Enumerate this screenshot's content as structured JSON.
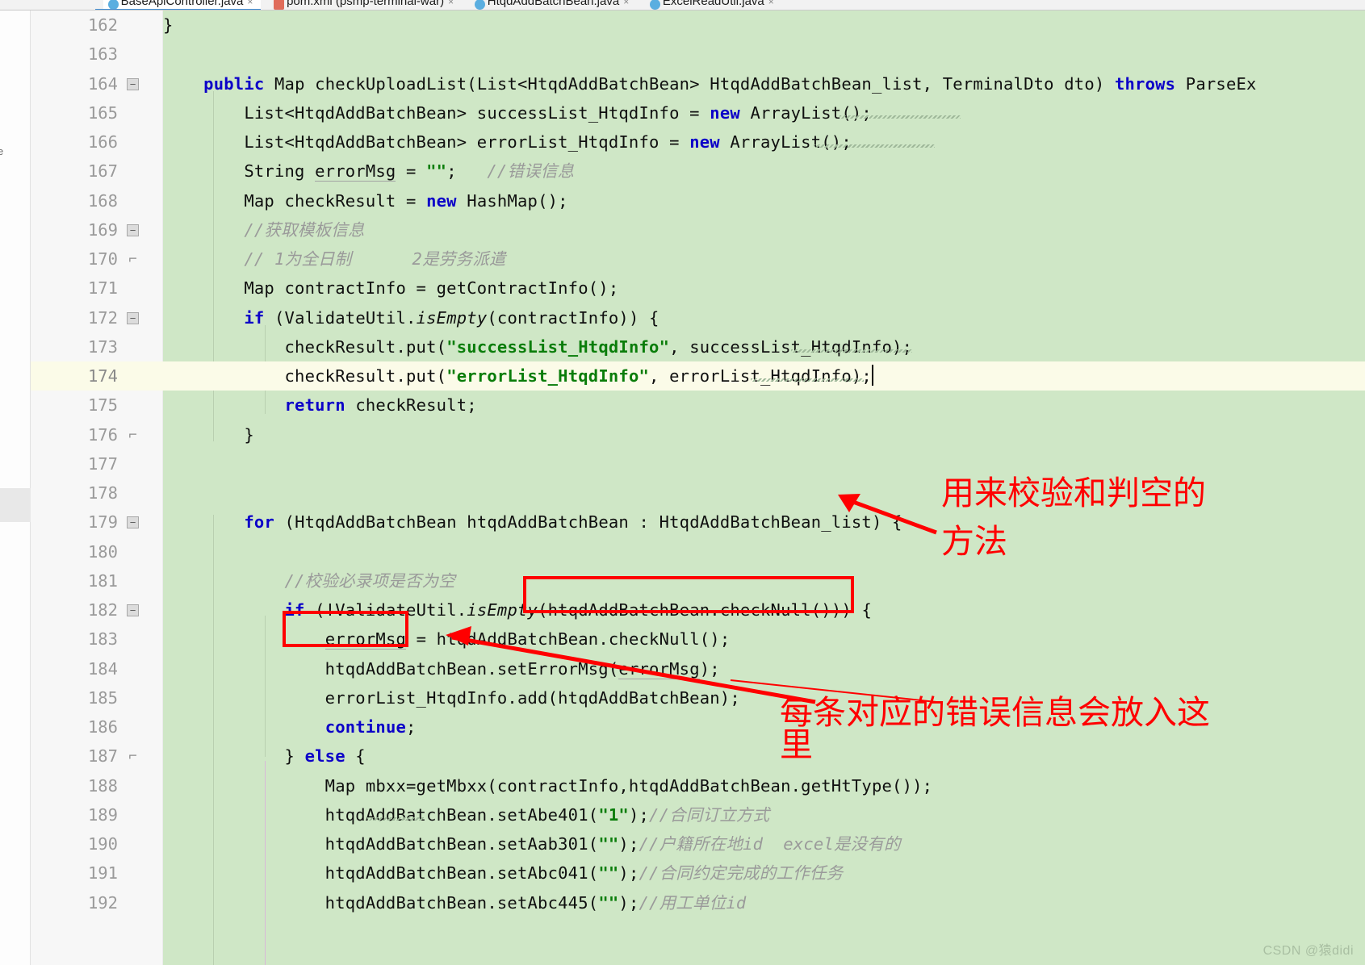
{
  "editor": {
    "tabs": [
      {
        "label": "BaseApiController.java",
        "icon": "java-class-icon",
        "active": true
      },
      {
        "label": "pom.xml (psmp-terminal-war)",
        "icon": "xml-file-icon",
        "active": false
      },
      {
        "label": "HtqdAddBatchBean.java",
        "icon": "java-class-icon",
        "active": false
      },
      {
        "label": "ExcelReadUtil.java",
        "icon": "java-class-icon",
        "active": false
      }
    ],
    "close_glyph": "×",
    "side_label": "e",
    "background_color": "#cfe7c6",
    "highlight_color": "#fbfbe8",
    "annotation_color": "#ff0000",
    "keyword_color": "#0c00c8",
    "string_color": "#0a7d0a",
    "comment_color": "#9a9a9a"
  },
  "lines": [
    {
      "no": "162",
      "indent": 1,
      "partial": true,
      "tokens": [
        {
          "t": "}",
          "c": "plain"
        }
      ]
    },
    {
      "no": "163",
      "tokens": []
    },
    {
      "no": "164",
      "fold": "minus",
      "tokens": [
        {
          "t": "    ",
          "c": "plain"
        },
        {
          "t": "public",
          "c": "kw"
        },
        {
          "t": " Map checkUploadList(List<HtqdAddBatchBean> HtqdAddBatchBean_list, TerminalDto dto) ",
          "c": "plain"
        },
        {
          "t": "throws",
          "c": "kw"
        },
        {
          "t": " ParseEx",
          "c": "plain"
        }
      ]
    },
    {
      "no": "165",
      "tokens": [
        {
          "t": "        List<HtqdAddBatchBean> successList_HtqdInfo = ",
          "c": "plain"
        },
        {
          "t": "new",
          "c": "kw"
        },
        {
          "t": " ArrayList();",
          "c": "plain"
        }
      ]
    },
    {
      "no": "166",
      "tokens": [
        {
          "t": "        List<HtqdAddBatchBean> errorList_HtqdInfo = ",
          "c": "plain"
        },
        {
          "t": "new",
          "c": "kw"
        },
        {
          "t": " ArrayList();",
          "c": "plain"
        }
      ]
    },
    {
      "no": "167",
      "tokens": [
        {
          "t": "        String ",
          "c": "plain"
        },
        {
          "t": "errorMsg",
          "c": "grey-underline"
        },
        {
          "t": " = ",
          "c": "plain"
        },
        {
          "t": "\"\"",
          "c": "str"
        },
        {
          "t": ";   ",
          "c": "plain"
        },
        {
          "t": "//错误信息",
          "c": "cmt"
        }
      ]
    },
    {
      "no": "168",
      "tokens": [
        {
          "t": "        Map checkResult = ",
          "c": "plain"
        },
        {
          "t": "new",
          "c": "kw"
        },
        {
          "t": " HashMap();",
          "c": "plain"
        }
      ]
    },
    {
      "no": "169",
      "fold": "minus",
      "tokens": [
        {
          "t": "        //获取模板信息",
          "c": "cmt"
        }
      ]
    },
    {
      "no": "170",
      "fold": "brace",
      "tokens": [
        {
          "t": "        // 1为全日制      2是劳务派遣",
          "c": "cmt"
        }
      ]
    },
    {
      "no": "171",
      "tokens": [
        {
          "t": "        Map contractInfo = getContractInfo();",
          "c": "plain"
        }
      ]
    },
    {
      "no": "172",
      "fold": "minus",
      "tokens": [
        {
          "t": "        ",
          "c": "plain"
        },
        {
          "t": "if",
          "c": "kw"
        },
        {
          "t": " (ValidateUtil.",
          "c": "plain"
        },
        {
          "t": "isEmpty",
          "c": "ital"
        },
        {
          "t": "(contractInfo)) {",
          "c": "plain"
        }
      ]
    },
    {
      "no": "173",
      "tokens": [
        {
          "t": "            checkResult.put(",
          "c": "plain"
        },
        {
          "t": "\"successList_HtqdInfo\"",
          "c": "str"
        },
        {
          "t": ", successList_HtqdInfo);",
          "c": "plain"
        }
      ]
    },
    {
      "no": "174",
      "highlight": true,
      "tokens": [
        {
          "t": "            checkResult.put(",
          "c": "plain"
        },
        {
          "t": "\"errorList_HtqdInfo\"",
          "c": "str"
        },
        {
          "t": ", errorList_HtqdInfo);",
          "c": "plain"
        },
        {
          "t": "|",
          "c": "caret"
        }
      ]
    },
    {
      "no": "175",
      "tokens": [
        {
          "t": "            ",
          "c": "plain"
        },
        {
          "t": "return",
          "c": "kw"
        },
        {
          "t": " checkResult;",
          "c": "plain"
        }
      ]
    },
    {
      "no": "176",
      "fold": "brace",
      "tokens": [
        {
          "t": "        }",
          "c": "plain"
        }
      ]
    },
    {
      "no": "177",
      "tokens": []
    },
    {
      "no": "178",
      "tokens": []
    },
    {
      "no": "179",
      "fold": "minus",
      "tokens": [
        {
          "t": "        ",
          "c": "plain"
        },
        {
          "t": "for",
          "c": "kw"
        },
        {
          "t": " (HtqdAddBatchBean htqdAddBatchBean : HtqdAddBatchBean_list) {",
          "c": "plain"
        }
      ]
    },
    {
      "no": "180",
      "tokens": []
    },
    {
      "no": "181",
      "tokens": [
        {
          "t": "            //校验必录项是否为空",
          "c": "cmt"
        }
      ]
    },
    {
      "no": "182",
      "fold": "minus",
      "tokens": [
        {
          "t": "            ",
          "c": "plain"
        },
        {
          "t": "if",
          "c": "kw"
        },
        {
          "t": " (!ValidateUtil.",
          "c": "plain"
        },
        {
          "t": "isEmpty",
          "c": "ital"
        },
        {
          "t": "(htqdAddBatchBean.checkNull())) {",
          "c": "plain"
        }
      ]
    },
    {
      "no": "183",
      "tokens": [
        {
          "t": "                ",
          "c": "plain"
        },
        {
          "t": "errorMsg",
          "c": "grey-underline"
        },
        {
          "t": " = htqdAddBatchBean.checkNull();",
          "c": "plain"
        }
      ]
    },
    {
      "no": "184",
      "tokens": [
        {
          "t": "                htqdAddBatchBean.setErrorMsg(",
          "c": "plain"
        },
        {
          "t": "errorMsg",
          "c": "grey-underline"
        },
        {
          "t": ");",
          "c": "plain"
        }
      ]
    },
    {
      "no": "185",
      "tokens": [
        {
          "t": "                errorList_HtqdInfo.add(htqdAddBatchBean);",
          "c": "plain"
        }
      ]
    },
    {
      "no": "186",
      "tokens": [
        {
          "t": "                ",
          "c": "plain"
        },
        {
          "t": "continue",
          "c": "kw"
        },
        {
          "t": ";",
          "c": "plain"
        }
      ]
    },
    {
      "no": "187",
      "fold": "brace",
      "tokens": [
        {
          "t": "            } ",
          "c": "plain"
        },
        {
          "t": "else",
          "c": "kw"
        },
        {
          "t": " {",
          "c": "plain"
        }
      ]
    },
    {
      "no": "188",
      "tokens": [
        {
          "t": "                Map mbxx=getMbxx(contractInfo,htqdAddBatchBean.getHtType());",
          "c": "plain"
        }
      ]
    },
    {
      "no": "189",
      "tokens": [
        {
          "t": "                htqdAddBatchBean.setAbe401(",
          "c": "plain"
        },
        {
          "t": "\"1\"",
          "c": "str"
        },
        {
          "t": ");",
          "c": "plain"
        },
        {
          "t": "//合同订立方式",
          "c": "cmt"
        }
      ]
    },
    {
      "no": "190",
      "tokens": [
        {
          "t": "                htqdAddBatchBean.setAab301(",
          "c": "plain"
        },
        {
          "t": "\"\"",
          "c": "str"
        },
        {
          "t": ");",
          "c": "plain"
        },
        {
          "t": "//户籍所在地id  excel是没有的",
          "c": "cmt"
        }
      ]
    },
    {
      "no": "191",
      "tokens": [
        {
          "t": "                htqdAddBatchBean.setAbc041(",
          "c": "plain"
        },
        {
          "t": "\"\"",
          "c": "str"
        },
        {
          "t": ");",
          "c": "plain"
        },
        {
          "t": "//合同约定完成的工作任务",
          "c": "cmt"
        }
      ]
    },
    {
      "no": "192",
      "partial": true,
      "tokens": [
        {
          "t": "                htqdAddBatchBean.setAbc445(",
          "c": "plain"
        },
        {
          "t": "\"\"",
          "c": "str"
        },
        {
          "t": ");",
          "c": "plain"
        },
        {
          "t": "//用工单位id",
          "c": "cmt"
        }
      ]
    }
  ],
  "annotations": {
    "note_top": "用来校验和判空的\n方法",
    "note_top_line1": "用来校验和判空的",
    "note_top_line2": "方法",
    "note_bottom_line1": "每条对应的错误信息会放入这",
    "note_bottom_line2": "里"
  },
  "watermark": {
    "text": "CSDN @猿didi"
  }
}
